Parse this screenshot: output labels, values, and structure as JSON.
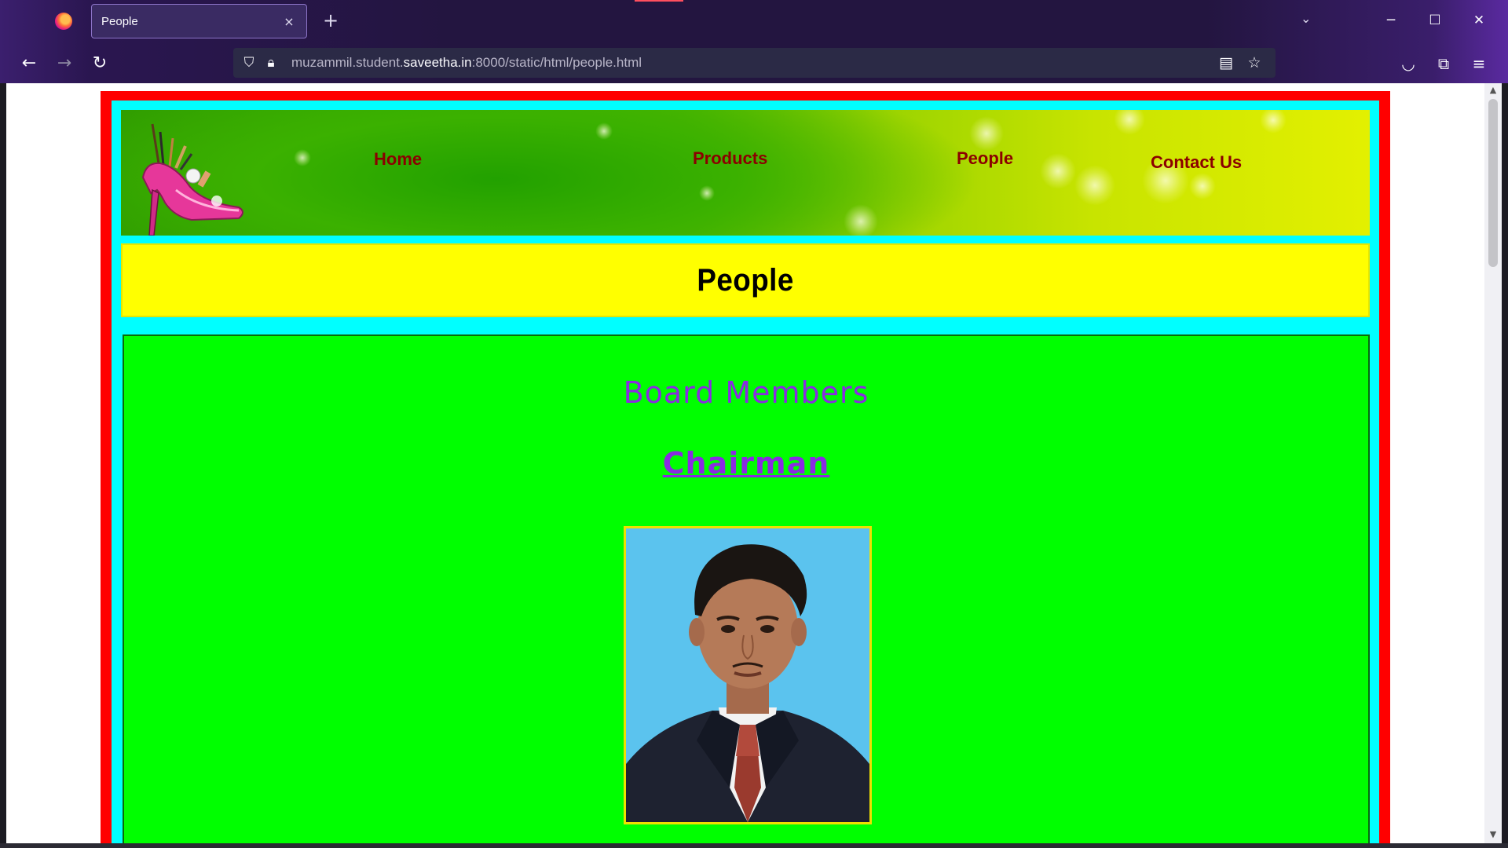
{
  "browser": {
    "tab_title": "People",
    "tab_close": "×",
    "new_tab": "+",
    "url_host_prefix": "muzammil.student.",
    "url_host": "saveetha.in",
    "url_path": ":8000/static/html/people.html"
  },
  "site": {
    "nav": [
      {
        "label": "Home"
      },
      {
        "label": "Products"
      },
      {
        "label": "People"
      },
      {
        "label": "Contact Us"
      }
    ],
    "page_title": "People",
    "section_title": "Board Members",
    "role_link": "Chairman"
  },
  "colors": {
    "outer_border": "#ff0000",
    "inner_border": "#00ffff",
    "title_bg": "#ffff00",
    "content_bg": "#00ff00",
    "nav_text": "#8b0000",
    "heading_text": "#8a2be2"
  }
}
